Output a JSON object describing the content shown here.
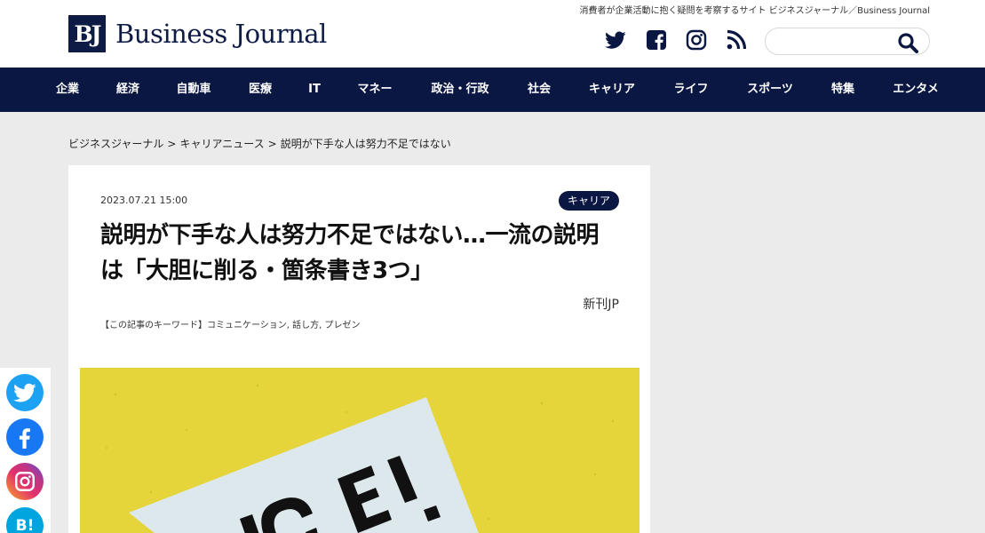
{
  "header": {
    "tagline": "消費者が企業活動に抱く疑問を考察するサイト ビジネスジャーナル／Business Journal",
    "logo_mark": "BJ",
    "logo_text": "Business Journal",
    "social_icons": [
      "twitter-icon",
      "facebook-icon",
      "instagram-icon",
      "rss-icon"
    ],
    "search": {
      "value": "",
      "placeholder": ""
    }
  },
  "nav": {
    "items": [
      "企業",
      "経済",
      "自動車",
      "医療",
      "IT",
      "マネー",
      "政治・行政",
      "社会",
      "キャリア",
      "ライフ",
      "スポーツ",
      "特集",
      "エンタメ"
    ]
  },
  "breadcrumb": {
    "items": [
      "ビジネスジャーナル",
      ">",
      "キャリアニュース",
      ">",
      "説明が下手な人は努力不足ではない"
    ]
  },
  "article": {
    "date": "2023.07.21 15:00",
    "category": "キャリア",
    "title": "説明が下手な人は努力不足ではない…一流の説明は「大胆に削る・箇条書き3つ」",
    "author": "新刊JP",
    "keywords": "【この記事のキーワード】コミュニケーション, 話し方, プレゼン",
    "hero_image": "yellow-background-card-photo"
  },
  "share": {
    "buttons": [
      "twitter-share-icon",
      "facebook-share-icon",
      "instagram-share-icon",
      "hatena-bookmark-icon"
    ],
    "hatena_label": "B!"
  },
  "colors": {
    "navy": "#0a1743",
    "twitter": "#1da1f2",
    "facebook": "#1877f2",
    "hatena": "#00a4de",
    "hero_yellow": "#e5d53a"
  }
}
